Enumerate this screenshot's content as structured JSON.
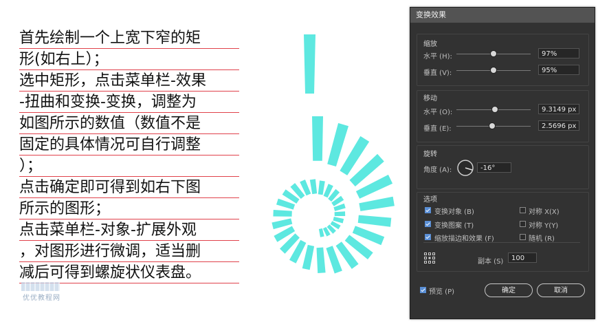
{
  "instructions": {
    "lines": [
      "首先绘制一个上宽下窄的矩",
      "形(如右上）；",
      "选中矩形，点击菜单栏-效果",
      "-扭曲和变换-变换，调整为",
      "如图所示的数值（数值不是",
      "固定的具体情况可自行调整",
      "）；",
      "点击确定即可得到如右下图",
      "所示的图形；",
      "点击菜单栏-对象-扩展外观",
      "，对图形进行微调，适当删",
      "减后可得到螺旋状仪表盘。"
    ]
  },
  "watermark": {
    "text": "优优教程网"
  },
  "colors": {
    "shape": "#5de8e0",
    "accent": "#5a8fd6",
    "panel_bg": "#323232"
  },
  "dialog": {
    "title": "变换效果",
    "scale": {
      "title": "缩放",
      "horizontal_label": "水平 (H):",
      "horizontal_value": "97%",
      "horizontal_slider": 0.5,
      "vertical_label": "垂直 (V):",
      "vertical_value": "95%",
      "vertical_slider": 0.5
    },
    "move": {
      "title": "移动",
      "horizontal_label": "水平 (O):",
      "horizontal_value": "9.3149 px",
      "horizontal_slider": 0.52,
      "vertical_label": "垂直 (E):",
      "vertical_value": "2.5696 px",
      "vertical_slider": 0.48
    },
    "rotate": {
      "title": "旋转",
      "angle_label": "角度 (A):",
      "angle_value": "-16°",
      "angle_icon": "angle-dial-icon"
    },
    "options": {
      "title": "选项",
      "transform_objects": "变换对象 (B)",
      "transform_objects_checked": true,
      "transform_patterns": "变换图案 (T)",
      "transform_patterns_checked": true,
      "scale_strokes": "缩放描边和效果 (F)",
      "scale_strokes_checked": true,
      "reflect_x": "对称 X(X)",
      "reflect_x_checked": false,
      "reflect_y": "对称 Y(Y)",
      "reflect_y_checked": false,
      "random": "随机 (R)",
      "random_checked": false,
      "reference_point_icon": "reference-point-grid-icon",
      "copies_label": "副本 (S)",
      "copies_value": "100"
    },
    "preview_label": "预览 (P)",
    "preview_checked": true,
    "ok_label": "确定",
    "cancel_label": "取消"
  }
}
